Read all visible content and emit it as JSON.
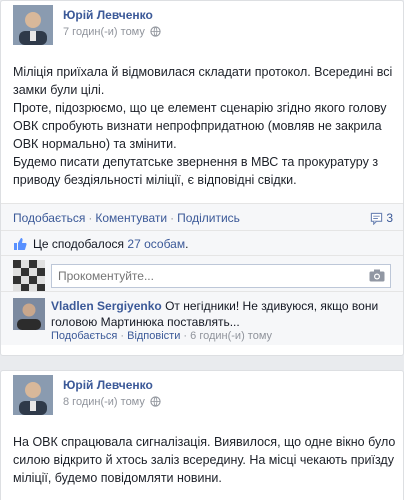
{
  "posts": [
    {
      "author": "Юрій Левченко",
      "time": "7 годин(-и) тому",
      "paragraphs": [
        "Міліція приїхала й відмовилася складати протокол. Всередині всі замки були цілі.",
        "Проте, підозрюємо, що це елемент сценарію згідно якого голову ОВК спробують визнати непрофпридатною (мовляв не закрила ОВК нормально) та змінити.",
        "Будемо писати депутатське звернення в МВС та прокуратуру з приводу бездіяльності міліції, є відповідні свідки."
      ],
      "actions": {
        "like": "Подобається",
        "comment": "Коментувати",
        "share": "Поділитись"
      },
      "comment_count": "3",
      "likes": {
        "prefix": "Це сподобалося",
        "count_link": "27 особам",
        "suffix": "."
      },
      "comment_input": {
        "placeholder": "Прокоментуйте..."
      },
      "comments": [
        {
          "author": "Vladlen Sergiyenko",
          "text": "От негідники! Не здивуюся, якщо вони головою Мартинюка поставлять...",
          "like": "Подобається",
          "reply": "Відповісти",
          "time": "6 годин(-и) тому"
        }
      ]
    },
    {
      "author": "Юрій Левченко",
      "time": "8 годин(-и) тому",
      "paragraphs": [
        "На ОВК спрацювала сигналізація. Виявилося, що одне вікно було силою відкрито й хтось заліз всередину. На місці чекають приїзду міліції, будемо повідомляти новини."
      ]
    }
  ],
  "colors": {
    "link": "#3b5998",
    "meta": "#90949c",
    "background": "#e9ebee"
  }
}
